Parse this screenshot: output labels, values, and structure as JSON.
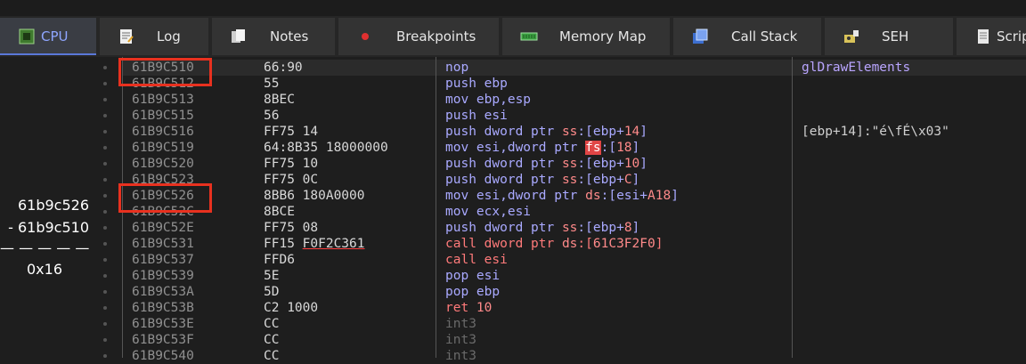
{
  "tabs": [
    {
      "label": "CPU",
      "icon": "cpu-icon",
      "active": true
    },
    {
      "label": "Log",
      "icon": "log-icon"
    },
    {
      "label": "Notes",
      "icon": "notes-icon"
    },
    {
      "label": "Breakpoints",
      "icon": "breakpoint-dot-icon"
    },
    {
      "label": "Memory Map",
      "icon": "memory-map-icon"
    },
    {
      "label": "Call Stack",
      "icon": "call-stack-icon"
    },
    {
      "label": "SEH",
      "icon": "seh-icon"
    },
    {
      "label": "Script",
      "icon": "script-icon"
    }
  ],
  "calc": {
    "line1": "61b9c526",
    "line2": "- 61b9c510",
    "divider": "— — — — —",
    "result": "0x16"
  },
  "rows": [
    {
      "addr": "61B9C510",
      "bytes": "66:90",
      "disasm": [
        {
          "t": "nop",
          "c": "mn"
        }
      ],
      "comment": "glDrawElements",
      "comment_color": "#b9a5ff"
    },
    {
      "addr": "61B9C512",
      "bytes": "55",
      "disasm": [
        {
          "t": "push ebp",
          "c": "mn"
        }
      ]
    },
    {
      "addr": "61B9C513",
      "bytes": "8BEC",
      "disasm": [
        {
          "t": "mov ebp,esp",
          "c": "mn"
        }
      ]
    },
    {
      "addr": "61B9C515",
      "bytes": "56",
      "disasm": [
        {
          "t": "push esi",
          "c": "mn"
        }
      ]
    },
    {
      "addr": "61B9C516",
      "bytes": "FF75 14",
      "disasm": [
        {
          "t": "push dword ptr ",
          "c": "mn"
        },
        {
          "t": "ss",
          "c": "seg"
        },
        {
          "t": ":[ebp+",
          "c": "mn"
        },
        {
          "t": "14",
          "c": "num"
        },
        {
          "t": "]",
          "c": "mn"
        }
      ],
      "comment": "[ebp+14]:\"é\\fÉ\\x03\""
    },
    {
      "addr": "61B9C519",
      "bytes": "64:8B35 18000000",
      "disasm": [
        {
          "t": "mov esi,dword ptr ",
          "c": "mn"
        },
        {
          "t": "fs",
          "c": "seg-hl"
        },
        {
          "t": ":[",
          "c": "mn"
        },
        {
          "t": "18",
          "c": "num"
        },
        {
          "t": "]",
          "c": "mn"
        }
      ]
    },
    {
      "addr": "61B9C520",
      "bytes": "FF75 10",
      "disasm": [
        {
          "t": "push dword ptr ",
          "c": "mn"
        },
        {
          "t": "ss",
          "c": "seg"
        },
        {
          "t": ":[ebp+",
          "c": "mn"
        },
        {
          "t": "10",
          "c": "num"
        },
        {
          "t": "]",
          "c": "mn"
        }
      ]
    },
    {
      "addr": "61B9C523",
      "bytes": "FF75 0C",
      "disasm": [
        {
          "t": "push dword ptr ",
          "c": "mn"
        },
        {
          "t": "ss",
          "c": "seg"
        },
        {
          "t": ":[ebp+",
          "c": "mn"
        },
        {
          "t": "C",
          "c": "num"
        },
        {
          "t": "]",
          "c": "mn"
        }
      ]
    },
    {
      "addr": "61B9C526",
      "bytes": "8BB6 180A0000",
      "disasm": [
        {
          "t": "mov esi,dword ptr ",
          "c": "mn"
        },
        {
          "t": "ds",
          "c": "seg"
        },
        {
          "t": ":[esi+",
          "c": "mn"
        },
        {
          "t": "A18",
          "c": "num"
        },
        {
          "t": "]",
          "c": "mn"
        }
      ]
    },
    {
      "addr": "61B9C52C",
      "bytes": "8BCE",
      "disasm": [
        {
          "t": "mov ecx,esi",
          "c": "mn"
        }
      ]
    },
    {
      "addr": "61B9C52E",
      "bytes": "FF75 08",
      "disasm": [
        {
          "t": "push dword ptr ",
          "c": "mn"
        },
        {
          "t": "ss",
          "c": "seg"
        },
        {
          "t": ":[ebp+",
          "c": "mn"
        },
        {
          "t": "8",
          "c": "num"
        },
        {
          "t": "]",
          "c": "mn"
        }
      ]
    },
    {
      "addr": "61B9C531",
      "bytes": "FF15 F0F2C361",
      "bytes_underline": "F0F2C361",
      "disasm": [
        {
          "t": "call dword ptr ",
          "c": "op-call"
        },
        {
          "t": "ds",
          "c": "seg"
        },
        {
          "t": ":[",
          "c": "op-call"
        },
        {
          "t": "61C3F2F0",
          "c": "num"
        },
        {
          "t": "]",
          "c": "op-call"
        }
      ]
    },
    {
      "addr": "61B9C537",
      "bytes": "FFD6",
      "disasm": [
        {
          "t": "call esi",
          "c": "op-call"
        }
      ]
    },
    {
      "addr": "61B9C539",
      "bytes": "5E",
      "disasm": [
        {
          "t": "pop esi",
          "c": "mn"
        }
      ]
    },
    {
      "addr": "61B9C53A",
      "bytes": "5D",
      "disasm": [
        {
          "t": "pop ebp",
          "c": "mn"
        }
      ]
    },
    {
      "addr": "61B9C53B",
      "bytes": "C2 1000",
      "disasm": [
        {
          "t": "ret ",
          "c": "op-ret"
        },
        {
          "t": "10",
          "c": "num"
        }
      ]
    },
    {
      "addr": "61B9C53E",
      "bytes": "CC",
      "disasm": [
        {
          "t": "int3",
          "c": "op-int3"
        }
      ]
    },
    {
      "addr": "61B9C53F",
      "bytes": "CC",
      "disasm": [
        {
          "t": "int3",
          "c": "op-int3"
        }
      ]
    },
    {
      "addr": "61B9C540",
      "bytes": "CC",
      "disasm": [
        {
          "t": "int3",
          "c": "op-int3"
        }
      ]
    }
  ],
  "highlighted_rows": [
    0,
    8
  ],
  "colors": {
    "accent": "#8fa6ff",
    "highlight_box": "#e8311f",
    "mnemonic": "#a9a9ff",
    "call": "#ff7a7a",
    "address": "#909090"
  }
}
